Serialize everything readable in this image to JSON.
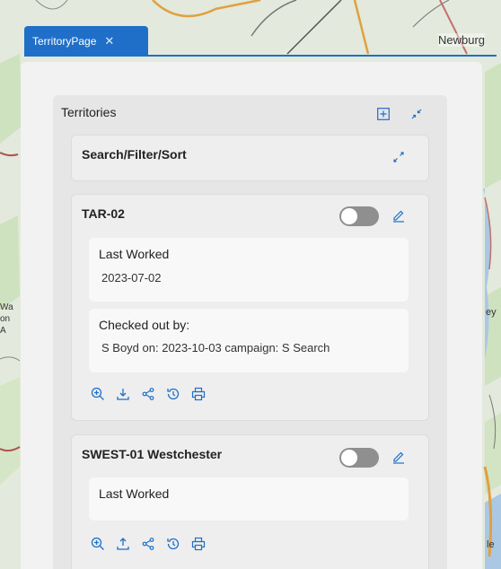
{
  "map": {
    "place_labels": [
      "Newburg",
      "Wa",
      "on",
      "A",
      "ey",
      "le"
    ]
  },
  "tab": {
    "label": "TerritoryPage",
    "close_glyph": "✕"
  },
  "territories": {
    "title": "Territories",
    "add_icon": "add-square-icon",
    "collapse_icon": "collapse-arrows-icon",
    "search_card": {
      "title": "Search/Filter/Sort",
      "expand_icon": "expand-arrows-icon"
    },
    "cards": [
      {
        "name": "TAR-02",
        "toggle_on": false,
        "last_worked_label": "Last Worked",
        "last_worked_value": "2023-07-02",
        "checked_out_label": "Checked out by:",
        "checked_out_value": "S Boyd on: 2023-10-03 campaign: S Search",
        "actions": [
          "zoom-in-icon",
          "download-icon",
          "share-icon",
          "history-icon",
          "print-icon"
        ]
      },
      {
        "name": "SWEST-01 Westchester",
        "toggle_on": false,
        "last_worked_label": "Last Worked",
        "last_worked_value": "",
        "actions": [
          "zoom-in-icon",
          "upload-icon",
          "share-icon",
          "history-icon",
          "print-icon"
        ]
      }
    ]
  },
  "colors": {
    "accent": "#1f6fc8",
    "panel": "#f2f2f2",
    "section": "#e6e6e6",
    "toggle_off": "#8f8f8f"
  }
}
